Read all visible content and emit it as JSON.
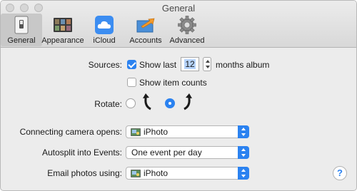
{
  "window": {
    "title": "General"
  },
  "toolbar": {
    "items": [
      {
        "label": "General",
        "icon": "general-switch-icon",
        "active": true
      },
      {
        "label": "Appearance",
        "icon": "appearance-icon",
        "active": false
      },
      {
        "label": "iCloud",
        "icon": "icloud-icon",
        "active": false
      },
      {
        "label": "Accounts",
        "icon": "accounts-icon",
        "active": false
      },
      {
        "label": "Advanced",
        "icon": "gear-icon",
        "active": false
      }
    ]
  },
  "sources": {
    "label": "Sources:",
    "show_last_label": "Show last",
    "show_last_checked": true,
    "months_value": "12",
    "months_suffix": "months album",
    "show_item_counts_label": "Show item counts",
    "show_item_counts_checked": false
  },
  "rotate": {
    "label": "Rotate:",
    "options": [
      {
        "icon": "rotate-counterclockwise-icon",
        "selected": false
      },
      {
        "icon": "rotate-clockwise-icon",
        "selected": true
      }
    ]
  },
  "camera": {
    "label": "Connecting camera opens:",
    "value": "iPhoto",
    "icon": "iphoto-icon"
  },
  "autosplit": {
    "label": "Autosplit into Events:",
    "value": "One event per day"
  },
  "email": {
    "label": "Email photos using:",
    "value": "iPhoto",
    "icon": "iphoto-icon"
  },
  "help": {
    "glyph": "?"
  },
  "colors": {
    "accent": "#2b82f0",
    "window_bg": "#ececec",
    "toolbar_active": "#c8c8c8"
  }
}
